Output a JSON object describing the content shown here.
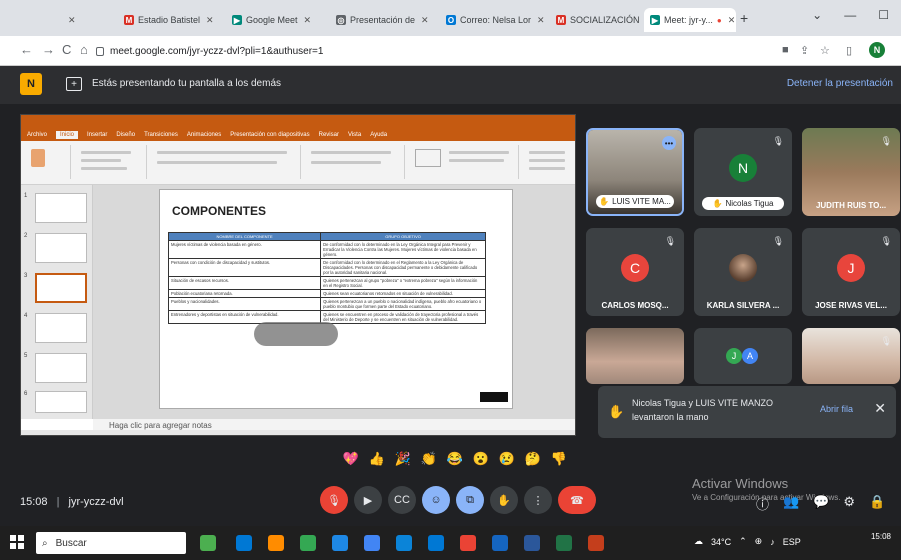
{
  "browser": {
    "tabs": [
      {
        "label": "",
        "active": false
      },
      {
        "label": "Estadio Batistel",
        "active": false
      },
      {
        "label": "Google Meet",
        "active": false
      },
      {
        "label": "Presentación de",
        "active": false
      },
      {
        "label": "Correo: Nelsa Lor",
        "active": false
      },
      {
        "label": "SOCIALIZACIÓN",
        "active": false
      },
      {
        "label": "Meet: jyr-y...",
        "active": true
      }
    ],
    "new_tab": "+",
    "url": "meet.google.com/jyr-yczz-dvl?pli=1&authuser=1",
    "profile_initial": "N"
  },
  "meet": {
    "presenting_text": "Estás presentando tu pantalla a los demás",
    "stop_presenting": "Detener la presentación",
    "meeting_time": "15:08",
    "meeting_code": "jyr-yczz-dvl",
    "separator": "|",
    "participants": [
      {
        "name": "LUIS VITE MA...",
        "initial": "",
        "color": "",
        "pill": true
      },
      {
        "name": "Nicolas Tigua",
        "initial": "N",
        "color": "#188038",
        "pill": true
      },
      {
        "name": "JUDITH RUIS TO...",
        "initial": "",
        "color": "",
        "pill": false
      },
      {
        "name": "CARLOS MOSQ...",
        "initial": "C",
        "color": "#e8453c",
        "pill": false
      },
      {
        "name": "KARLA SILVERA ...",
        "initial": "",
        "color": "",
        "pill": false
      },
      {
        "name": "JOSE RIVAS VEL...",
        "initial": "J",
        "color": "#e8453c",
        "pill": false
      }
    ],
    "extra_avatars": [
      "J",
      "A"
    ],
    "hand_notice": {
      "text": "Nicolas Tigua y LUIS VITE MANZO levantaron la mano",
      "action": "Abrir fila",
      "close": "✕"
    },
    "reactions": [
      "💖",
      "👍",
      "🎉",
      "👏",
      "😂",
      "😮",
      "😢",
      "🤔",
      "👎"
    ],
    "activate_windows": {
      "title": "Activar Windows",
      "subtitle": "Ve a Configuración para activar Windows."
    }
  },
  "slide": {
    "title": "COMPONENTES",
    "table_headers": [
      "NOMBRE DEL COMPONENTE",
      "GRUPO OBJETIVO"
    ],
    "table_rows": [
      [
        "Mujeres víctimas de violencia basada en género.",
        "De conformidad con lo determinado en la Ley Orgánica Integral para Prevenir y Erradicar la Violencia Contra las Mujeres. Mujeres víctimas de violencia basada en género."
      ],
      [
        "Personas con condición de discapacidad y sustitutos.",
        "De conformidad con lo determinado en el Reglamento a la Ley Orgánica de Discapacidades. Personas con discapacidad permanente o debidamente calificado por la autoridad sanitaria nacional."
      ],
      [
        "Situación de escasos recursos.",
        "Quienes pertenezcan al grupo \"pobreza\" o \"extrema pobreza\" según la información en el Registro Social."
      ],
      [
        "Población ecuatoriana retornada.",
        "Quienes sean ecuatorianos retornados en situación de vulnerabilidad."
      ],
      [
        "Pueblos y nacionalidades.",
        "Quienes pertenezcan a un pueblo o nacionalidad indígena, pueblo afro ecuatoriano o pueblo montubio que formen parte del Estado ecuatoriano."
      ],
      [
        "Entrenadores y deportistas en situación de vulnerabilidad.",
        "Quienes se encuentren en proceso de validación de trayectoria profesional a través del Ministerio de Deporte y se encuentren en situación de vulnerabilidad."
      ]
    ],
    "notes_placeholder": "Haga clic para agregar notas",
    "ribbon_tabs": [
      "Archivo",
      "Inicio",
      "Insertar",
      "Diseño",
      "Transiciones",
      "Animaciones",
      "Presentación con diapositivas",
      "Revisar",
      "Vista",
      "Ayuda"
    ]
  },
  "taskbar": {
    "search_placeholder": "Buscar",
    "temperature": "34°C",
    "language": "ESP",
    "time": "15:08"
  }
}
